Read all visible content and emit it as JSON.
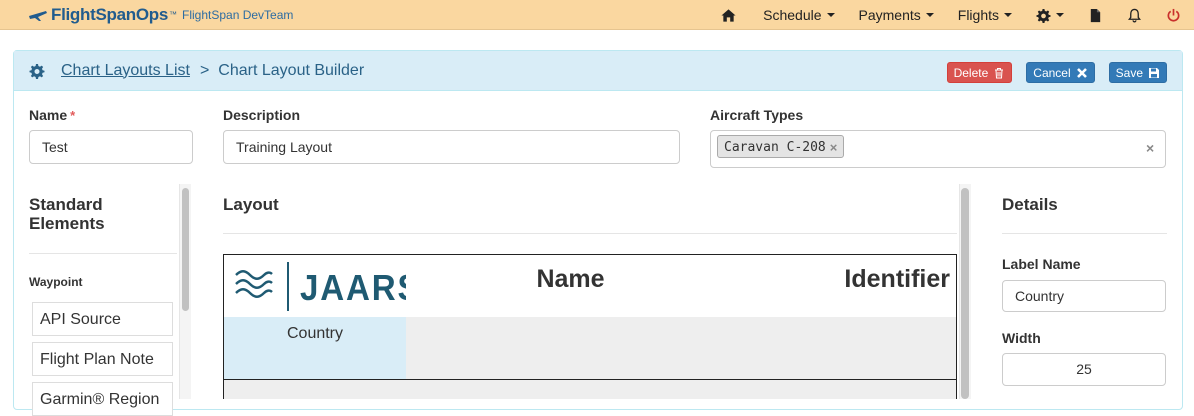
{
  "navbar": {
    "brand_name": "FlightSpanOps",
    "brand_tm": "™",
    "team": "FlightSpan DevTeam",
    "menus": [
      "Schedule",
      "Payments",
      "Flights"
    ]
  },
  "header": {
    "breadcrumb_link": "Chart Layouts List",
    "breadcrumb_sep": ">",
    "breadcrumb_current": "Chart Layout Builder",
    "delete_label": "Delete",
    "cancel_label": "Cancel",
    "save_label": "Save"
  },
  "form": {
    "name_label": "Name",
    "required_mark": "*",
    "name_value": "Test",
    "description_label": "Description",
    "description_value": "Training Layout",
    "aircraft_label": "Aircraft Types",
    "aircraft_tags": [
      "Caravan C-208"
    ],
    "tag_remove": "×",
    "clear_all": "×"
  },
  "standard_elements": {
    "title": "Standard Elements",
    "group": "Waypoint",
    "items": [
      "API Source",
      "Flight Plan Note",
      "Garmin® Region"
    ]
  },
  "layout": {
    "title": "Layout",
    "logo_text": "JAARS",
    "columns": [
      "Name",
      "Identifier"
    ],
    "selected_cell": "Country"
  },
  "details": {
    "title": "Details",
    "label_name_label": "Label Name",
    "label_name_value": "Country",
    "width_label": "Width",
    "width_value": "25"
  },
  "colors": {
    "navbar_bg": "#fad7a0",
    "brand": "#215c8e",
    "panel_heading_bg": "#d9edf7",
    "delete_btn": "#d9534f",
    "primary_btn": "#337ab7",
    "selected_cell_bg": "#d9edf7",
    "logo_teal": "#1f5a72"
  }
}
